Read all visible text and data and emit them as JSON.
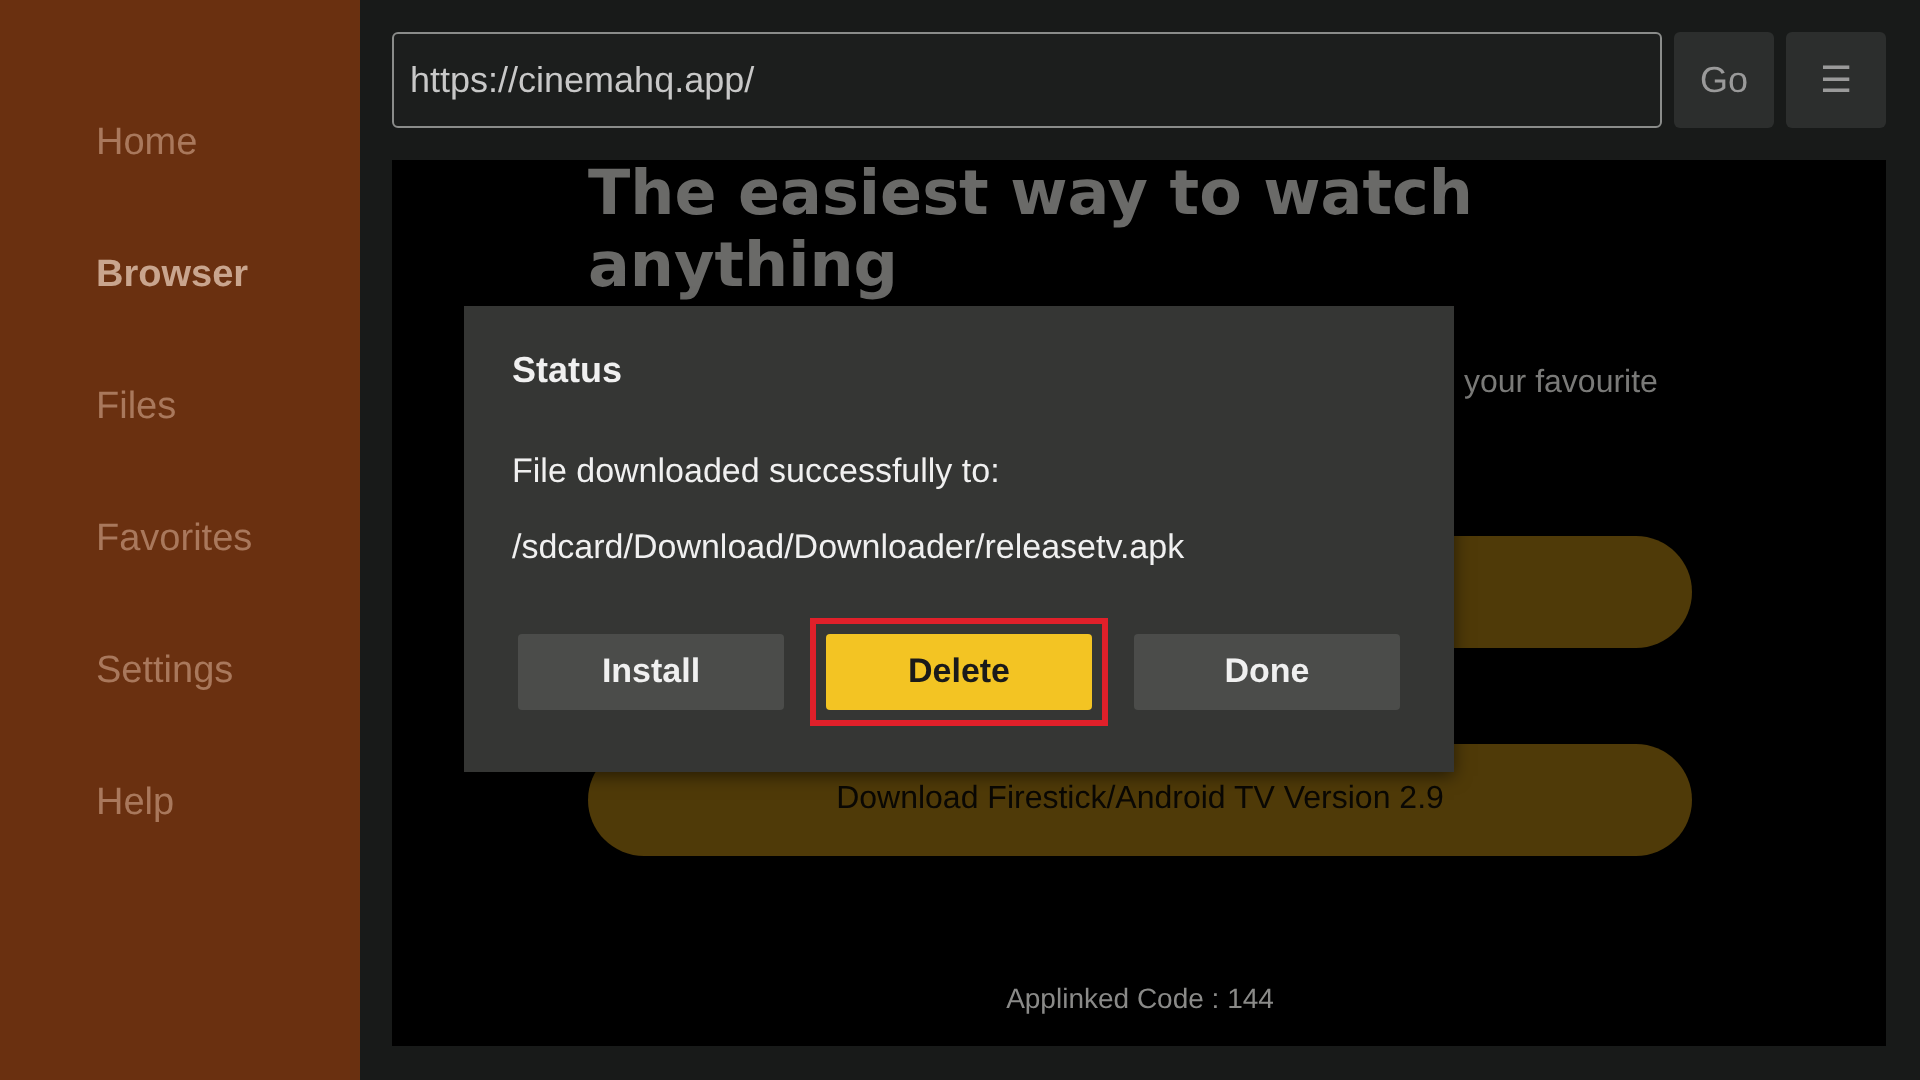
{
  "sidebar": {
    "items": [
      {
        "label": "Home",
        "selected": false
      },
      {
        "label": "Browser",
        "selected": true
      },
      {
        "label": "Files",
        "selected": false
      },
      {
        "label": "Favorites",
        "selected": false
      },
      {
        "label": "Settings",
        "selected": false
      },
      {
        "label": "Help",
        "selected": false
      }
    ]
  },
  "url_bar": {
    "value": "https://cinemahq.app/",
    "go": "Go",
    "menu": "☰"
  },
  "page": {
    "headline": "The easiest way to watch anything",
    "tagline_fragment": "your favourite",
    "buttons": [
      {
        "kind": "covered"
      },
      {
        "kind": "labeled",
        "label": "Download Firestick/Android TV Version 2.9"
      }
    ],
    "footer": "Applinked Code : 144"
  },
  "dialog": {
    "title": "Status",
    "message": "File downloaded successfully to:",
    "path": "/sdcard/Download/Downloader/releasetv.apk",
    "buttons": [
      {
        "label": "Install",
        "focused": false,
        "highlighted": false
      },
      {
        "label": "Delete",
        "focused": true,
        "highlighted": true
      },
      {
        "label": "Done",
        "focused": false,
        "highlighted": false
      }
    ]
  }
}
